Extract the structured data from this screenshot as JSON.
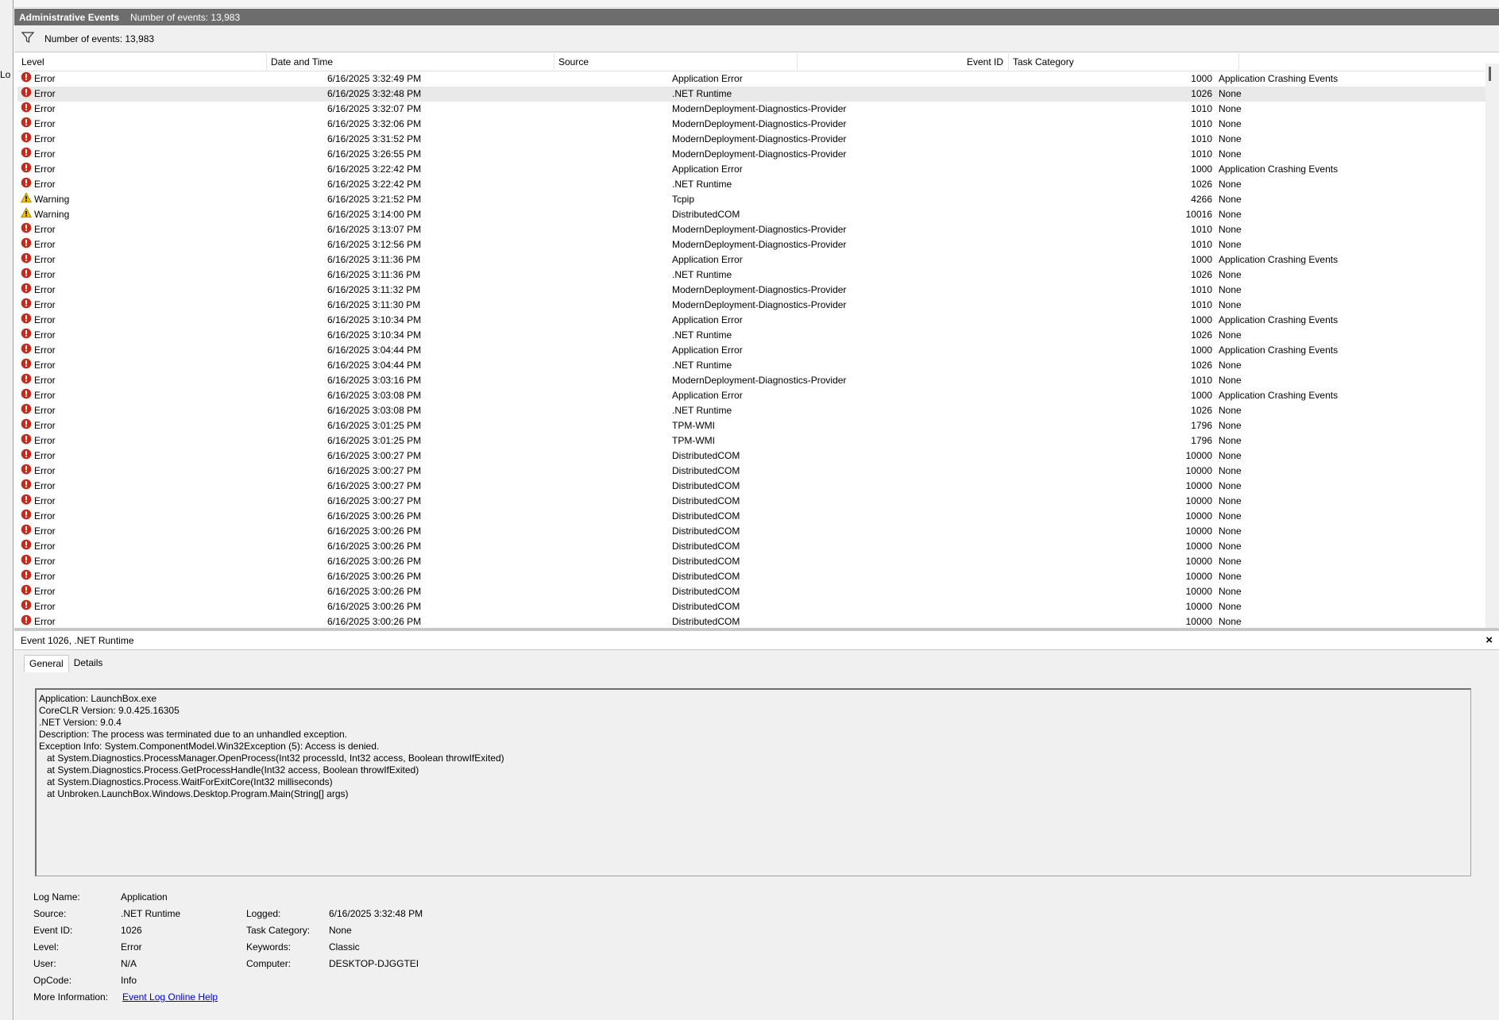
{
  "side": {
    "partial_label": "Lo"
  },
  "title": {
    "name": "Administrative Events",
    "count": "Number of events: 13,983"
  },
  "filter": {
    "count": "Number of events: 13,983"
  },
  "columns": {
    "level": "Level",
    "date": "Date and Time",
    "source": "Source",
    "event_id": "Event ID",
    "category": "Task Category"
  },
  "rows": [
    {
      "level": "Error",
      "date": "6/16/2025 3:32:49 PM",
      "source": "Application Error",
      "id": "1000",
      "cat": "Application Crashing Events"
    },
    {
      "level": "Error",
      "date": "6/16/2025 3:32:48 PM",
      "source": ".NET Runtime",
      "id": "1026",
      "cat": "None",
      "selected": true
    },
    {
      "level": "Error",
      "date": "6/16/2025 3:32:07 PM",
      "source": "ModernDeployment-Diagnostics-Provider",
      "id": "1010",
      "cat": "None"
    },
    {
      "level": "Error",
      "date": "6/16/2025 3:32:06 PM",
      "source": "ModernDeployment-Diagnostics-Provider",
      "id": "1010",
      "cat": "None"
    },
    {
      "level": "Error",
      "date": "6/16/2025 3:31:52 PM",
      "source": "ModernDeployment-Diagnostics-Provider",
      "id": "1010",
      "cat": "None"
    },
    {
      "level": "Error",
      "date": "6/16/2025 3:26:55 PM",
      "source": "ModernDeployment-Diagnostics-Provider",
      "id": "1010",
      "cat": "None"
    },
    {
      "level": "Error",
      "date": "6/16/2025 3:22:42 PM",
      "source": "Application Error",
      "id": "1000",
      "cat": "Application Crashing Events"
    },
    {
      "level": "Error",
      "date": "6/16/2025 3:22:42 PM",
      "source": ".NET Runtime",
      "id": "1026",
      "cat": "None"
    },
    {
      "level": "Warning",
      "date": "6/16/2025 3:21:52 PM",
      "source": "Tcpip",
      "id": "4266",
      "cat": "None"
    },
    {
      "level": "Warning",
      "date": "6/16/2025 3:14:00 PM",
      "source": "DistributedCOM",
      "id": "10016",
      "cat": "None"
    },
    {
      "level": "Error",
      "date": "6/16/2025 3:13:07 PM",
      "source": "ModernDeployment-Diagnostics-Provider",
      "id": "1010",
      "cat": "None"
    },
    {
      "level": "Error",
      "date": "6/16/2025 3:12:56 PM",
      "source": "ModernDeployment-Diagnostics-Provider",
      "id": "1010",
      "cat": "None"
    },
    {
      "level": "Error",
      "date": "6/16/2025 3:11:36 PM",
      "source": "Application Error",
      "id": "1000",
      "cat": "Application Crashing Events"
    },
    {
      "level": "Error",
      "date": "6/16/2025 3:11:36 PM",
      "source": ".NET Runtime",
      "id": "1026",
      "cat": "None"
    },
    {
      "level": "Error",
      "date": "6/16/2025 3:11:32 PM",
      "source": "ModernDeployment-Diagnostics-Provider",
      "id": "1010",
      "cat": "None"
    },
    {
      "level": "Error",
      "date": "6/16/2025 3:11:30 PM",
      "source": "ModernDeployment-Diagnostics-Provider",
      "id": "1010",
      "cat": "None"
    },
    {
      "level": "Error",
      "date": "6/16/2025 3:10:34 PM",
      "source": "Application Error",
      "id": "1000",
      "cat": "Application Crashing Events"
    },
    {
      "level": "Error",
      "date": "6/16/2025 3:10:34 PM",
      "source": ".NET Runtime",
      "id": "1026",
      "cat": "None"
    },
    {
      "level": "Error",
      "date": "6/16/2025 3:04:44 PM",
      "source": "Application Error",
      "id": "1000",
      "cat": "Application Crashing Events"
    },
    {
      "level": "Error",
      "date": "6/16/2025 3:04:44 PM",
      "source": ".NET Runtime",
      "id": "1026",
      "cat": "None"
    },
    {
      "level": "Error",
      "date": "6/16/2025 3:03:16 PM",
      "source": "ModernDeployment-Diagnostics-Provider",
      "id": "1010",
      "cat": "None"
    },
    {
      "level": "Error",
      "date": "6/16/2025 3:03:08 PM",
      "source": "Application Error",
      "id": "1000",
      "cat": "Application Crashing Events"
    },
    {
      "level": "Error",
      "date": "6/16/2025 3:03:08 PM",
      "source": ".NET Runtime",
      "id": "1026",
      "cat": "None"
    },
    {
      "level": "Error",
      "date": "6/16/2025 3:01:25 PM",
      "source": "TPM-WMI",
      "id": "1796",
      "cat": "None"
    },
    {
      "level": "Error",
      "date": "6/16/2025 3:01:25 PM",
      "source": "TPM-WMI",
      "id": "1796",
      "cat": "None"
    },
    {
      "level": "Error",
      "date": "6/16/2025 3:00:27 PM",
      "source": "DistributedCOM",
      "id": "10000",
      "cat": "None"
    },
    {
      "level": "Error",
      "date": "6/16/2025 3:00:27 PM",
      "source": "DistributedCOM",
      "id": "10000",
      "cat": "None"
    },
    {
      "level": "Error",
      "date": "6/16/2025 3:00:27 PM",
      "source": "DistributedCOM",
      "id": "10000",
      "cat": "None"
    },
    {
      "level": "Error",
      "date": "6/16/2025 3:00:27 PM",
      "source": "DistributedCOM",
      "id": "10000",
      "cat": "None"
    },
    {
      "level": "Error",
      "date": "6/16/2025 3:00:26 PM",
      "source": "DistributedCOM",
      "id": "10000",
      "cat": "None"
    },
    {
      "level": "Error",
      "date": "6/16/2025 3:00:26 PM",
      "source": "DistributedCOM",
      "id": "10000",
      "cat": "None"
    },
    {
      "level": "Error",
      "date": "6/16/2025 3:00:26 PM",
      "source": "DistributedCOM",
      "id": "10000",
      "cat": "None"
    },
    {
      "level": "Error",
      "date": "6/16/2025 3:00:26 PM",
      "source": "DistributedCOM",
      "id": "10000",
      "cat": "None"
    },
    {
      "level": "Error",
      "date": "6/16/2025 3:00:26 PM",
      "source": "DistributedCOM",
      "id": "10000",
      "cat": "None"
    },
    {
      "level": "Error",
      "date": "6/16/2025 3:00:26 PM",
      "source": "DistributedCOM",
      "id": "10000",
      "cat": "None"
    },
    {
      "level": "Error",
      "date": "6/16/2025 3:00:26 PM",
      "source": "DistributedCOM",
      "id": "10000",
      "cat": "None"
    },
    {
      "level": "Error",
      "date": "6/16/2025 3:00:26 PM",
      "source": "DistributedCOM",
      "id": "10000",
      "cat": "None"
    }
  ],
  "icons": {
    "Error": "error-icon",
    "Warning": "warning-icon",
    "filter": "filter-icon"
  },
  "colors": {
    "error": "#c42b1c",
    "warning": "#f2c200",
    "title_bg": "#6d6d6d",
    "selected_row": "#e9e9e9",
    "link": "#0000ee"
  },
  "detail": {
    "title": "Event 1026, .NET Runtime",
    "close": "×",
    "tabs": [
      "General",
      "Details"
    ],
    "description": [
      "Application: LaunchBox.exe",
      "CoreCLR Version: 9.0.425.16305",
      ".NET Version: 9.0.4",
      "Description: The process was terminated due to an unhandled exception.",
      "Exception Info: System.ComponentModel.Win32Exception (5): Access is denied.",
      "   at System.Diagnostics.ProcessManager.OpenProcess(Int32 processId, Int32 access, Boolean throwIfExited)",
      "   at System.Diagnostics.Process.GetProcessHandle(Int32 access, Boolean throwIfExited)",
      "   at System.Diagnostics.Process.WaitForExitCore(Int32 milliseconds)",
      "   at Unbroken.LaunchBox.Windows.Desktop.Program.Main(String[] args)"
    ],
    "props": {
      "log_name_label": "Log Name:",
      "log_name": "Application",
      "source_label": "Source:",
      "source": ".NET Runtime",
      "logged_label": "Logged:",
      "logged": "6/16/2025 3:32:48 PM",
      "event_id_label": "Event ID:",
      "event_id": "1026",
      "task_category_label": "Task Category:",
      "task_category": "None",
      "level_label": "Level:",
      "level": "Error",
      "keywords_label": "Keywords:",
      "keywords": "Classic",
      "user_label": "User:",
      "user": "N/A",
      "computer_label": "Computer:",
      "computer": "DESKTOP-DJGGTEI",
      "opcode_label": "OpCode:",
      "opcode": "Info",
      "more_info_label": "More Information:",
      "more_info_link": "Event Log Online Help"
    }
  }
}
